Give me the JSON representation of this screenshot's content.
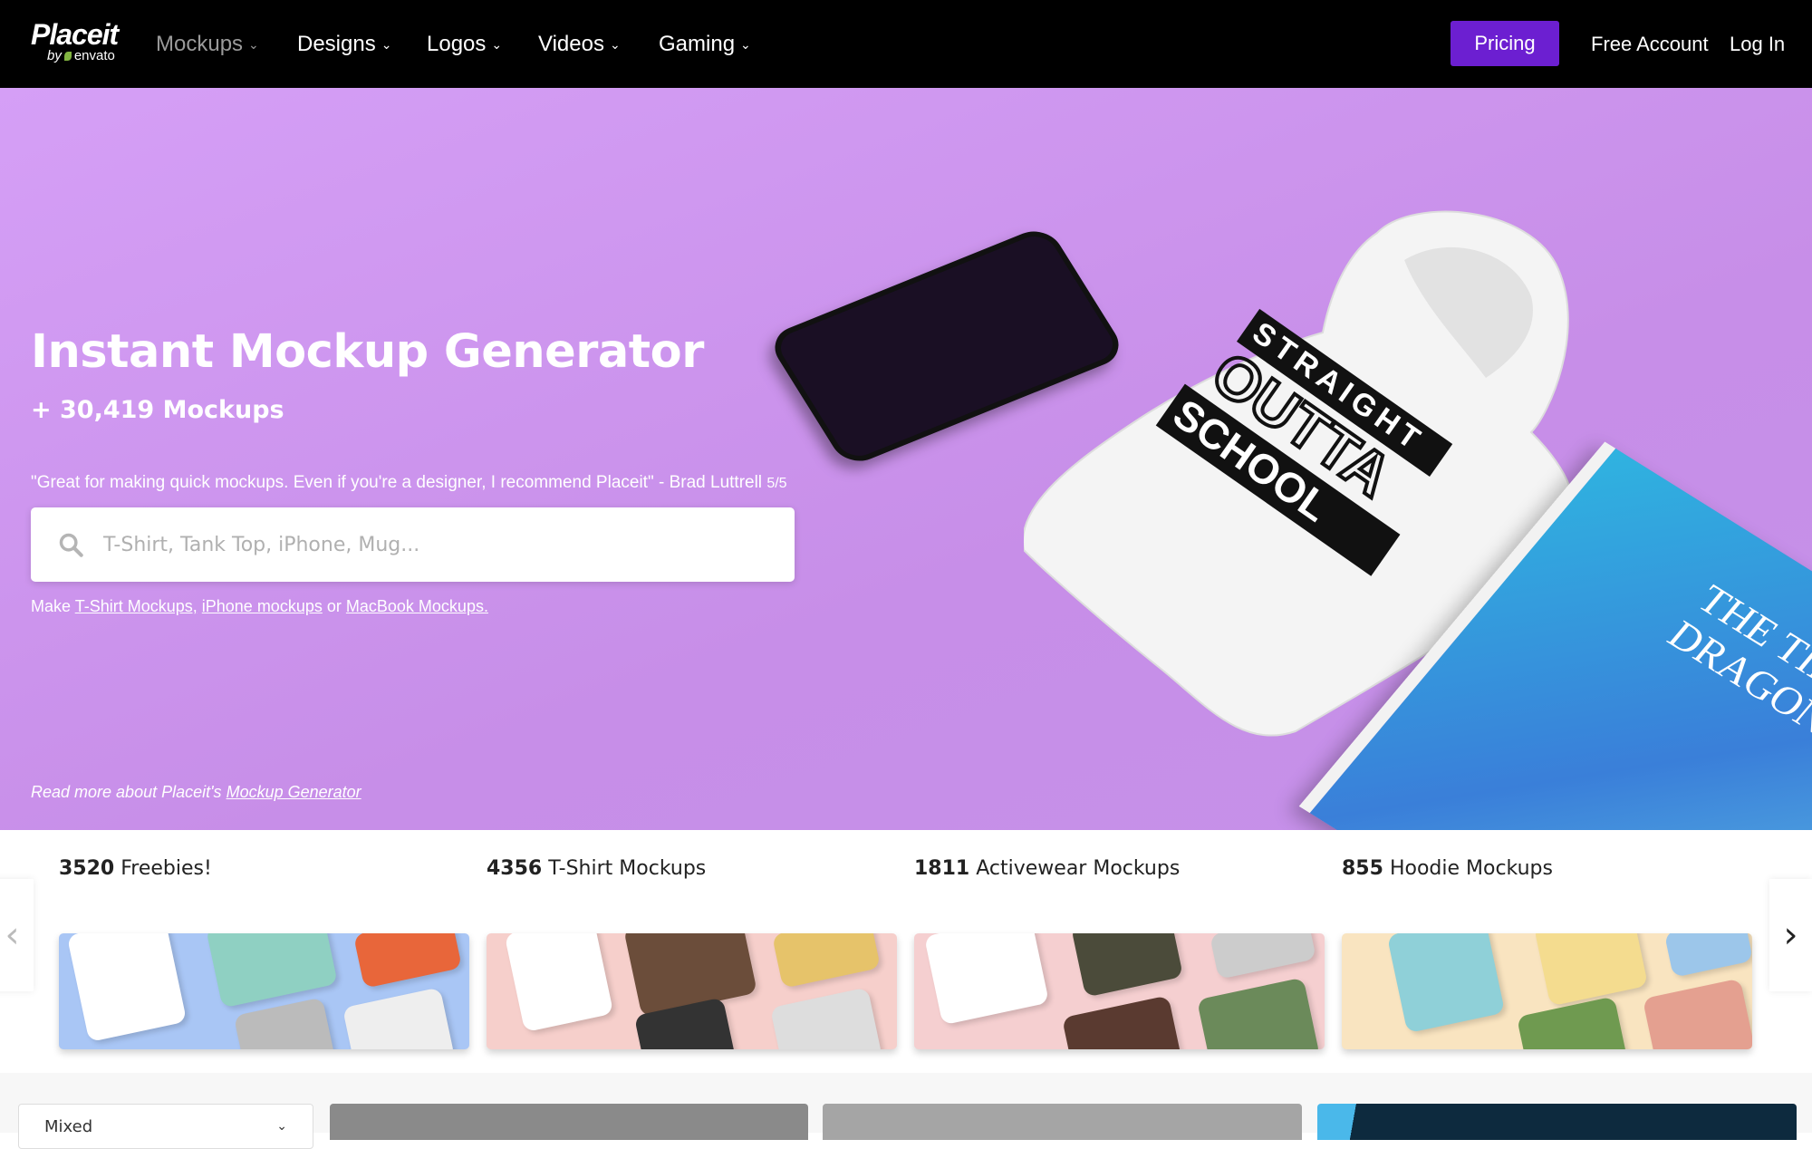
{
  "nav": {
    "logo_text": "Placeit",
    "logo_sub": "envato",
    "menu": [
      {
        "label": "Mockups",
        "active": false
      },
      {
        "label": "Designs"
      },
      {
        "label": "Logos"
      },
      {
        "label": "Videos"
      },
      {
        "label": "Gaming"
      }
    ],
    "pricing_label": "Pricing",
    "free_account_label": "Free Account",
    "login_label": "Log In",
    "accent_color": "#6c1fd1"
  },
  "hero": {
    "title": "Instant Mockup Generator",
    "subtitle": "+ 30,419 Mockups",
    "quote": "\"Great for making quick mockups. Even if you're a designer, I recommend Placeit\" - Brad Luttrell",
    "rating": "5/5",
    "search_placeholder": "T-Shirt, Tank Top, iPhone, Mug...",
    "make_prefix": "Make",
    "make_links": [
      "T-Shirt Mockups,",
      "iPhone mockups",
      "MacBook Mockups."
    ],
    "make_or": "or",
    "read_more_prefix": "Read more about Placeit's",
    "read_more_link": "Mockup Generator",
    "hoodie_text": [
      "STRAIGHT",
      "OUTTA",
      "SCHOOL"
    ],
    "book_title": "THE TINY DRAGON"
  },
  "categories": [
    {
      "count": "3520",
      "label": "Freebies!",
      "color": "#a9c6f5"
    },
    {
      "count": "4356",
      "label": "T-Shirt Mockups",
      "color": "#f6cfcb"
    },
    {
      "count": "1811",
      "label": "Activewear Mockups",
      "color": "#f5cfd0"
    },
    {
      "count": "855",
      "label": "Hoodie Mockups",
      "color": "#f9e4c0"
    }
  ],
  "filter": {
    "selected": "Mixed"
  }
}
